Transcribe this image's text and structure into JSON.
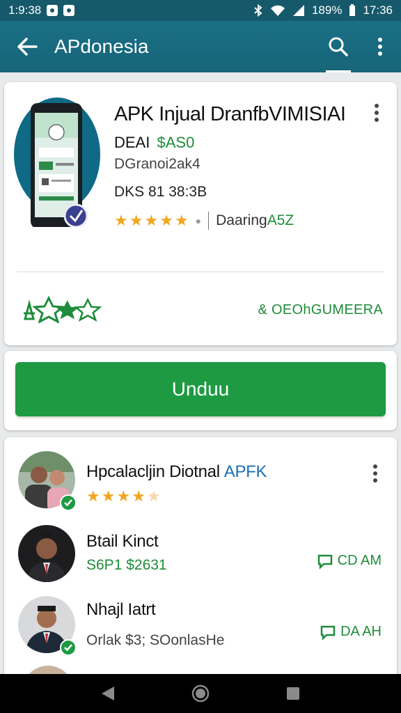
{
  "status_bar": {
    "time_left": "1:9:38",
    "battery": "189%",
    "time_right": "17:36"
  },
  "app_bar": {
    "title": "APdonesia"
  },
  "app_card": {
    "title": "APK Injual DranfbVIMISIAI",
    "price_label": "DEAI",
    "price": "$AS0",
    "developer": "DGranoi2ak4",
    "size": "DKS 81 38:3B",
    "rating": 5,
    "downloads_label": "Daaring",
    "downloads_count": "A5Z",
    "more_link": "& OEOhGUMEERA"
  },
  "install_button": {
    "label": "Unduu"
  },
  "reviews": [
    {
      "name": "Hpcalacljin Diotnal",
      "tag": "APFK",
      "rating": 4.5,
      "subtitle": ""
    },
    {
      "name": "Btail Kinct",
      "subtitle": "S6P1 $2631",
      "action": "CD AM"
    },
    {
      "name": "Nhajl Iatrt",
      "subtitle": "Orlak $3; SOonlasHe",
      "action": "DA AH"
    }
  ],
  "colors": {
    "appbar": "#176579",
    "accent_green": "#1e9a43",
    "star": "#f2a51f"
  },
  "icons": [
    "back-arrow-icon",
    "search-icon",
    "more-vert-icon",
    "star-icon",
    "badge-icon",
    "comment-icon",
    "nav-back-icon",
    "nav-home-icon",
    "nav-recents-icon"
  ]
}
